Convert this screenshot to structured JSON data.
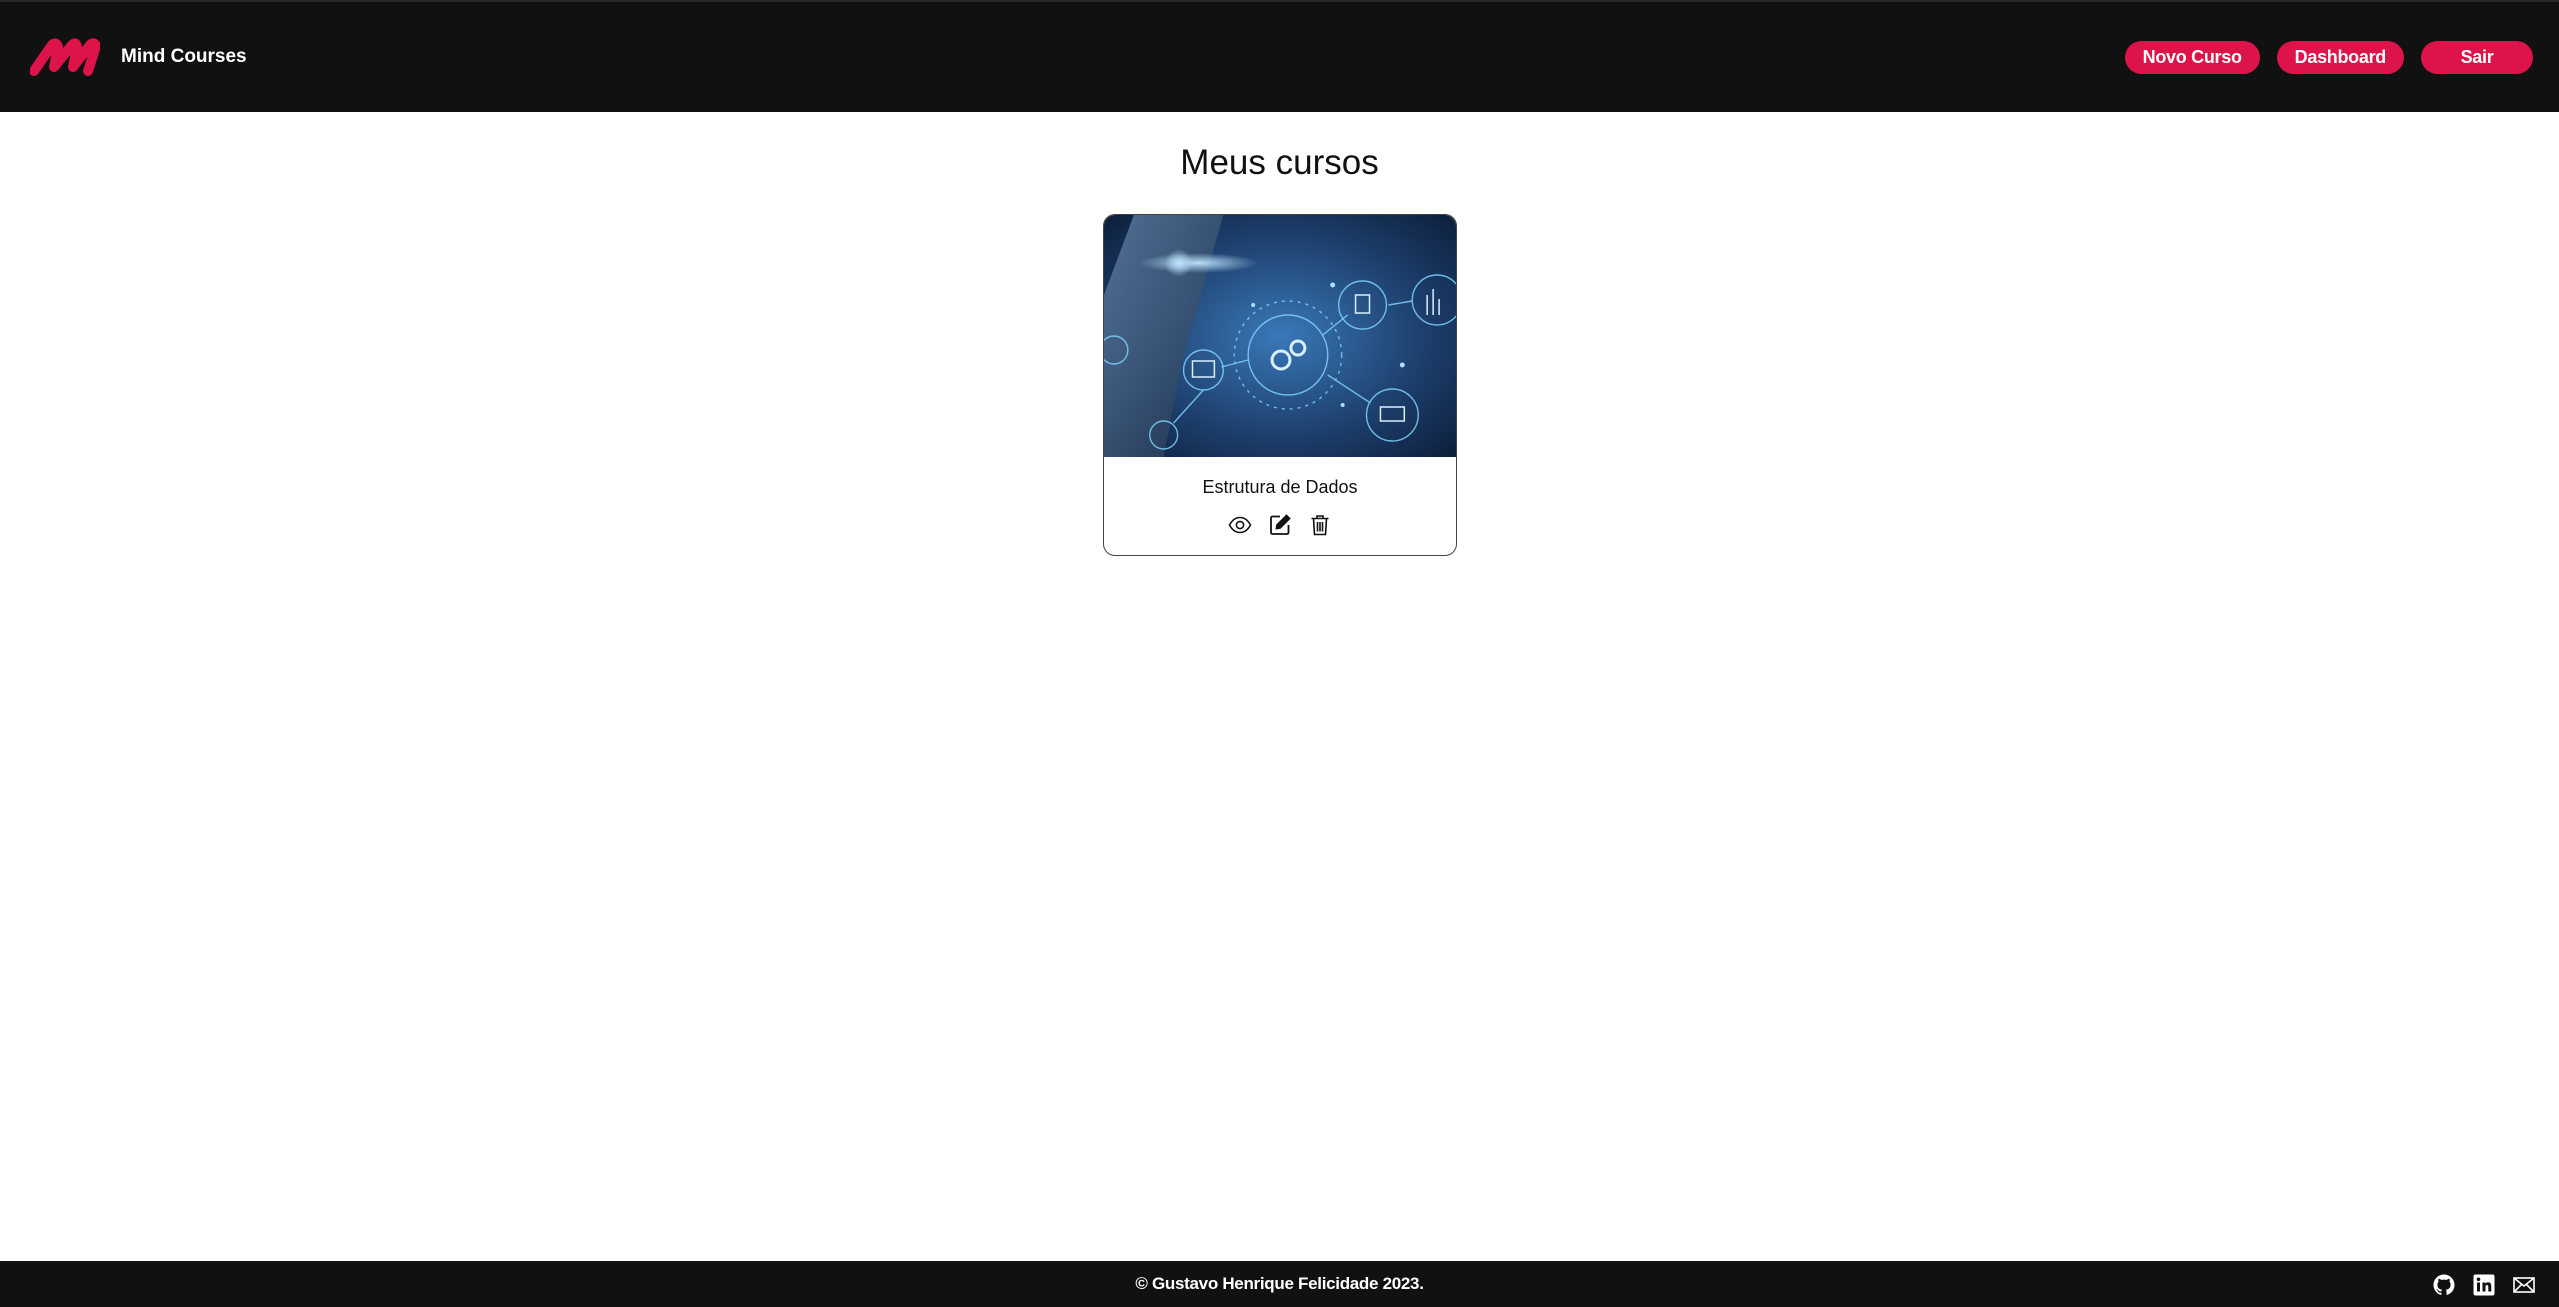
{
  "header": {
    "brand_name": "Mind Courses",
    "logo_icon": "mind-courses-logo",
    "nav": [
      {
        "label": "Novo Curso"
      },
      {
        "label": "Dashboard"
      },
      {
        "label": "Sair"
      }
    ]
  },
  "main": {
    "title": "Meus cursos",
    "courses": [
      {
        "title": "Estrutura de Dados",
        "image_icon": "technology-gears-banner",
        "actions": [
          "eye-icon",
          "edit-icon",
          "trash-icon"
        ]
      }
    ]
  },
  "footer": {
    "copyright": "© Gustavo Henrique Felicidade 2023.",
    "socials": [
      "github-icon",
      "linkedin-icon",
      "mail-icon"
    ]
  },
  "colors": {
    "accent": "#dd1449",
    "bar": "#111111",
    "background": "#ffffff"
  }
}
